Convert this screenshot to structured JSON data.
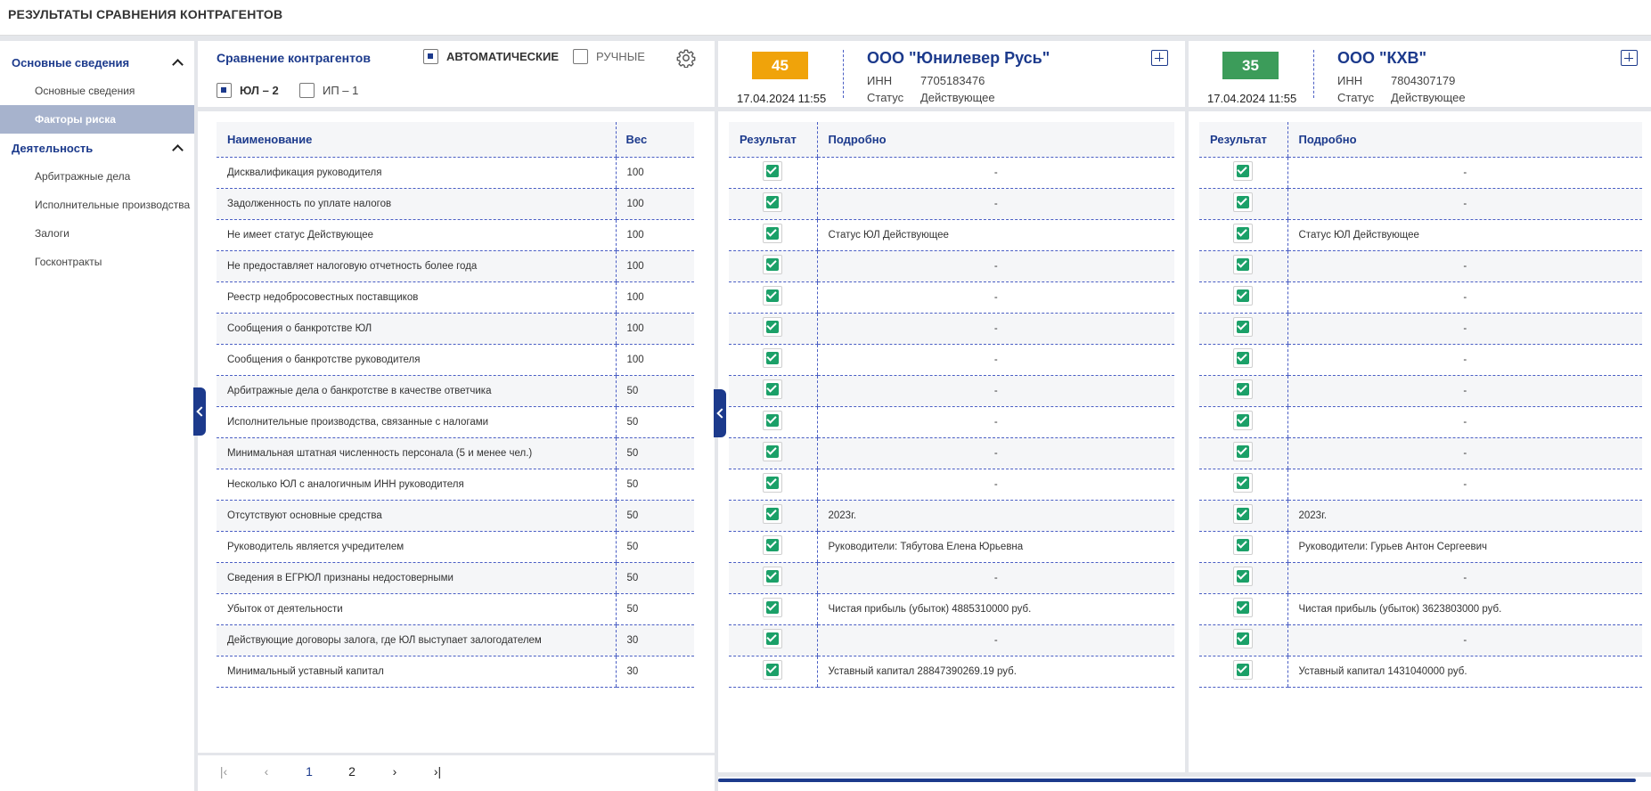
{
  "page_title": "РЕЗУЛЬТАТЫ СРАВНЕНИЯ КОНТРАГЕНТОВ",
  "sidebar": {
    "groups": [
      {
        "label": "Основные сведения",
        "items": [
          "Основные сведения",
          "Факторы риска"
        ],
        "active": 1
      },
      {
        "label": "Деятельность",
        "items": [
          "Арбитражные дела",
          "Исполнительные производства",
          "Залоги",
          "Госконтракты"
        ]
      }
    ]
  },
  "compare": {
    "title": "Сравнение контрагентов",
    "auto_label": "АВТОМАТИЧЕСКИЕ",
    "manual_label": "РУЧНЫЕ",
    "ul_label": "ЮЛ – 2",
    "ip_label": "ИП – 1"
  },
  "factors_table": {
    "col_name": "Наименование",
    "col_weight": "Вес",
    "rows": [
      {
        "name": "Дисквалификация руководителя",
        "weight": "100"
      },
      {
        "name": "Задолженность по уплате налогов",
        "weight": "100"
      },
      {
        "name": "Не имеет статус Действующее",
        "weight": "100"
      },
      {
        "name": "Не предоставляет налоговую отчетность более года",
        "weight": "100"
      },
      {
        "name": "Реестр недобросовестных поставщиков",
        "weight": "100"
      },
      {
        "name": "Сообщения о банкротстве ЮЛ",
        "weight": "100"
      },
      {
        "name": "Сообщения о банкротстве руководителя",
        "weight": "100"
      },
      {
        "name": "Арбитражные дела о банкротстве в качестве ответчика",
        "weight": "50"
      },
      {
        "name": "Исполнительные производства, связанные с налогами",
        "weight": "50"
      },
      {
        "name": "Минимальная штатная численность персонала (5 и менее чел.)",
        "weight": "50"
      },
      {
        "name": "Несколько ЮЛ с аналогичным ИНН руководителя",
        "weight": "50"
      },
      {
        "name": "Отсутствуют основные средства",
        "weight": "50"
      },
      {
        "name": "Руководитель является учредителем",
        "weight": "50"
      },
      {
        "name": "Сведения в ЕГРЮЛ признаны недостоверными",
        "weight": "50"
      },
      {
        "name": "Убыток от деятельности",
        "weight": "50"
      },
      {
        "name": "Действующие договоры залога, где ЮЛ выступает залогодателем",
        "weight": "30"
      },
      {
        "name": "Минимальный уставный капитал",
        "weight": "30"
      }
    ]
  },
  "pagination": {
    "pages": [
      "1",
      "2"
    ],
    "current": "1"
  },
  "companies": [
    {
      "score": "45",
      "score_color": "#f0a30a",
      "date": "17.04.2024 11:55",
      "name": "ООО \"Юнилевер Русь\"",
      "inn_label": "ИНН",
      "inn": "7705183476",
      "status_label": "Статус",
      "status": "Действующее",
      "col_result": "Результат",
      "col_details": "Подробно",
      "details": [
        "-",
        "-",
        "Статус ЮЛ Действующее",
        "-",
        "-",
        "-",
        "-",
        "-",
        "-",
        "-",
        "-",
        "2023г.",
        "Руководители: Тябутова Елена Юрьевна",
        "-",
        "Чистая прибыль (убыток) 4885310000 руб.",
        "-",
        "Уставный капитал 28847390269.19 руб."
      ]
    },
    {
      "score": "35",
      "score_color": "#3c9c5a",
      "date": "17.04.2024 11:55",
      "name": "ООО \"КХВ\"",
      "inn_label": "ИНН",
      "inn": "7804307179",
      "status_label": "Статус",
      "status": "Действующее",
      "col_result": "Результат",
      "col_details": "Подробно",
      "details": [
        "-",
        "-",
        "Статус ЮЛ Действующее",
        "-",
        "-",
        "-",
        "-",
        "-",
        "-",
        "-",
        "-",
        "2023г.",
        "Руководители: Гурьев Антон Сергеевич",
        "-",
        "Чистая прибыль (убыток) 3623803000 руб.",
        "-",
        "Уставный капитал 1431040000 руб."
      ]
    }
  ],
  "icons": {
    "settings": "gear-icon",
    "collapse": "chevron-up-icon",
    "handle": "chevron-left-icon",
    "card": "compare-layout-icon",
    "result": "check-icon"
  }
}
